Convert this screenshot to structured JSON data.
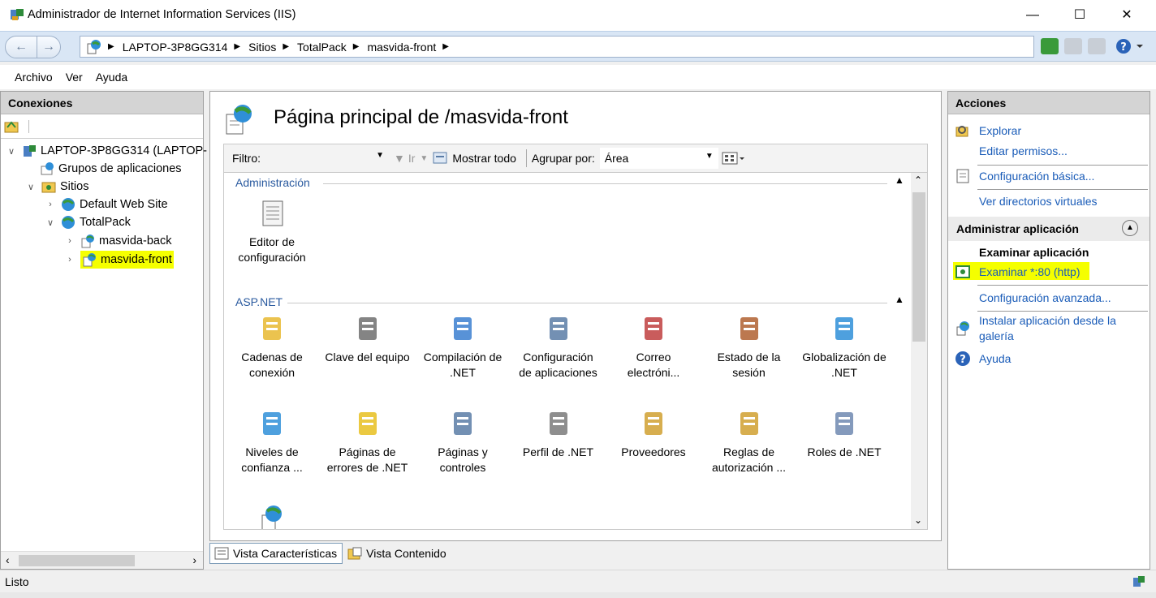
{
  "window": {
    "title": "Administrador de Internet Information Services (IIS)"
  },
  "address": {
    "crumbs": [
      "LAPTOP-3P8GG314",
      "Sitios",
      "TotalPack",
      "masvida-front"
    ]
  },
  "menu": {
    "items": [
      "Archivo",
      "Ver",
      "Ayuda"
    ]
  },
  "connections": {
    "header": "Conexiones",
    "tree": {
      "server": "LAPTOP-3P8GG314 (LAPTOP-",
      "app_pools": "Grupos de aplicaciones",
      "sites": "Sitios",
      "default_site": "Default Web Site",
      "totalpack": "TotalPack",
      "back": "masvida-back",
      "front": "masvida-front"
    }
  },
  "main": {
    "title": "Página principal de /masvida-front",
    "filter": {
      "label": "Filtro:",
      "go": "Ir",
      "show_all": "Mostrar todo",
      "group_label": "Agrupar por:",
      "group_value": "Área"
    },
    "groups": {
      "admin": {
        "label": "Administración",
        "features": [
          {
            "l1": "Editor de",
            "l2": "configuración"
          }
        ]
      },
      "aspnet": {
        "label": "ASP.NET",
        "features": [
          {
            "l1": "Cadenas de",
            "l2": "conexión"
          },
          {
            "l1": "Clave del equipo",
            "l2": ""
          },
          {
            "l1": "Compilación de",
            "l2": ".NET"
          },
          {
            "l1": "Configuración",
            "l2": "de aplicaciones"
          },
          {
            "l1": "Correo",
            "l2": "electróni..."
          },
          {
            "l1": "Estado de la",
            "l2": "sesión"
          },
          {
            "l1": "Globalización de",
            "l2": ".NET"
          },
          {
            "l1": "Niveles de",
            "l2": "confianza ..."
          },
          {
            "l1": "Páginas de",
            "l2": "errores de .NET"
          },
          {
            "l1": "Páginas y",
            "l2": "controles"
          },
          {
            "l1": "Perfil de .NET",
            "l2": ""
          },
          {
            "l1": "Proveedores",
            "l2": ""
          },
          {
            "l1": "Reglas de",
            "l2": "autorización ..."
          },
          {
            "l1": "Roles de .NET",
            "l2": ""
          }
        ]
      }
    },
    "view_tabs": [
      "Vista Características",
      "Vista Contenido"
    ]
  },
  "actions": {
    "header": "Acciones",
    "explore": "Explorar",
    "edit_perms": "Editar permisos...",
    "basic_config": "Configuración básica...",
    "virtual_dirs": "Ver directorios virtuales",
    "manage_app_header": "Administrar aplicación",
    "browse_app_header": "Examinar aplicación",
    "browse_80": "Examinar *:80 (http)",
    "advanced_config": "Configuración avanzada...",
    "install_app_1": "Instalar aplicación desde la",
    "install_app_2": "galería",
    "help": "Ayuda"
  },
  "status": {
    "text": "Listo"
  },
  "colors": {
    "link": "#1a5cb8",
    "highlight": "#f5ff00",
    "group_header": "#2a5a9f"
  }
}
